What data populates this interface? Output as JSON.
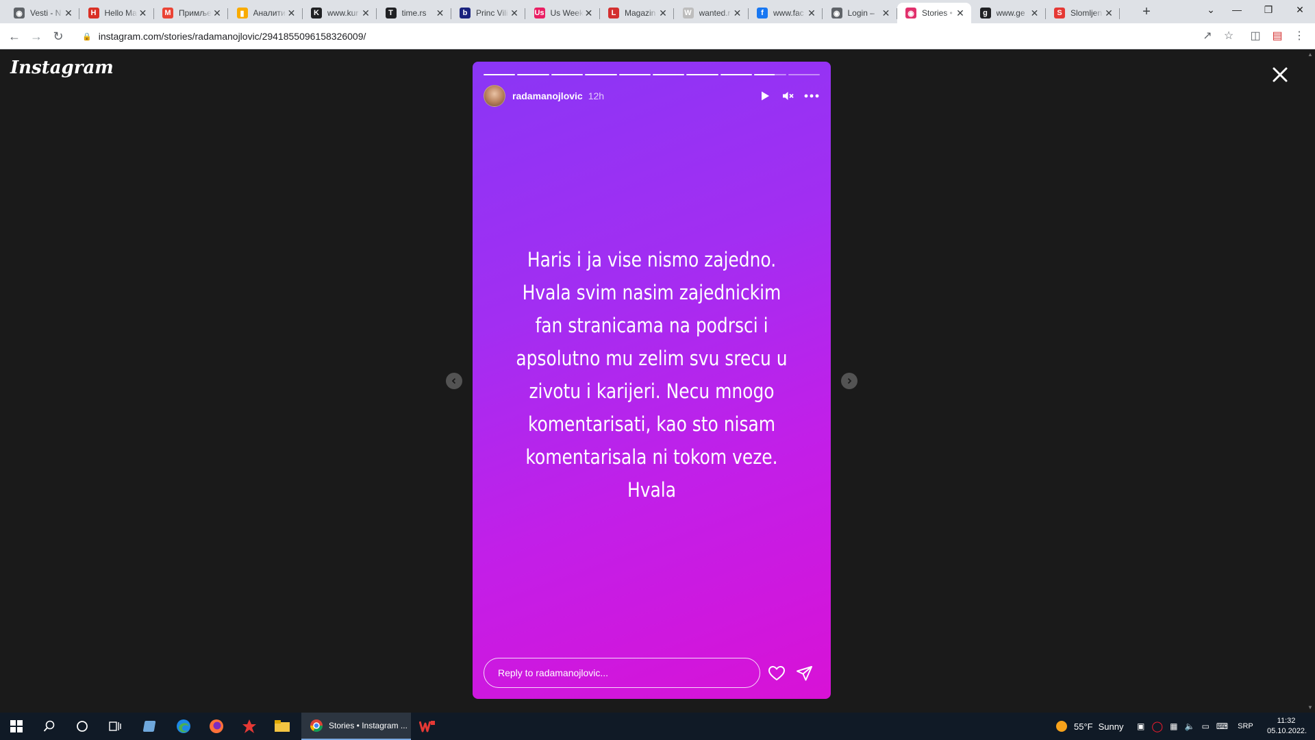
{
  "browser": {
    "tabs": [
      {
        "label": "Vesti - N",
        "icon": "globe-icon",
        "color": "#5f6368"
      },
      {
        "label": "Hello Ma",
        "icon": "hello-icon",
        "color": "#d93025"
      },
      {
        "label": "Примље",
        "icon": "gmail-icon",
        "color": "#ea4335"
      },
      {
        "label": "Аналити",
        "icon": "analytics-icon",
        "color": "#f9ab00"
      },
      {
        "label": "www.kur",
        "icon": "kurir-icon",
        "color": "#202124"
      },
      {
        "label": "time.rs",
        "icon": "time-icon",
        "color": "#202124"
      },
      {
        "label": "Princ Vili",
        "icon": "b92-icon",
        "color": "#1a237e"
      },
      {
        "label": "Us Week",
        "icon": "usweekly-icon",
        "color": "#e91e63"
      },
      {
        "label": "Magazin",
        "icon": "magazin-icon",
        "color": "#d32f2f"
      },
      {
        "label": "wanted.r",
        "icon": "wanted-icon",
        "color": "#bdbdbd"
      },
      {
        "label": "www.fac",
        "icon": "facebook-icon",
        "color": "#1877f2"
      },
      {
        "label": "Login – ",
        "icon": "globe-icon",
        "color": "#5f6368"
      },
      {
        "label": "Stories •",
        "icon": "instagram-icon",
        "color": "#e1306c",
        "active": true
      },
      {
        "label": "www.ge",
        "icon": "g-icon",
        "color": "#202124"
      },
      {
        "label": "Slomljen",
        "icon": "s-icon",
        "color": "#e53935"
      }
    ],
    "new_tab": "+",
    "url": "instagram.com/stories/radamanojlovic/2941855096158326009/"
  },
  "story": {
    "logo": "Instagram",
    "username": "radamanojlovic",
    "time": "12h",
    "text": "Haris i ja vise nismo zajedno. Hvala svim nasim zajednickim fan stranicama na podrsci i apsolutno mu zelim svu srecu u zivotu i karijeri. Necu mnogo komentarisati, kao sto nisam komentarisala ni tokom veze. Hvala",
    "reply_placeholder": "Reply to radamanojlovic...",
    "segments": [
      1,
      1,
      1,
      1,
      1,
      1,
      1,
      1,
      0.65,
      0
    ],
    "gradient": [
      "#8a36f5",
      "#d812d6"
    ]
  },
  "taskbar": {
    "active_window": "Stories • Instagram ...",
    "weather_temp": "55°F",
    "weather_desc": "Sunny",
    "language": "SRP",
    "time": "11:32",
    "date": "05.10.2022."
  }
}
